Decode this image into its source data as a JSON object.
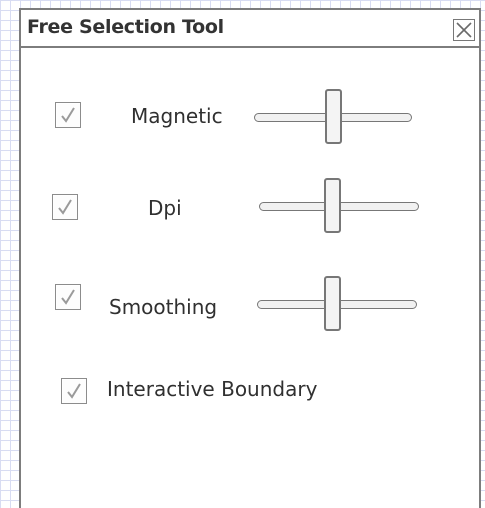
{
  "window": {
    "title": "Free Selection Tool",
    "close_icon": "close-x-box-icon"
  },
  "options": [
    {
      "label": "Magnetic",
      "checked": true,
      "slider_value": 0.5
    },
    {
      "label": "Dpi",
      "checked": true,
      "slider_value": 0.46
    },
    {
      "label": "Smoothing",
      "checked": true,
      "slider_value": 0.47
    },
    {
      "label": "Interactive Boundary",
      "checked": true
    }
  ],
  "colors": {
    "border": "#7d7d7d",
    "grid": "#d8dcf2",
    "check": "#9a9a9a"
  }
}
